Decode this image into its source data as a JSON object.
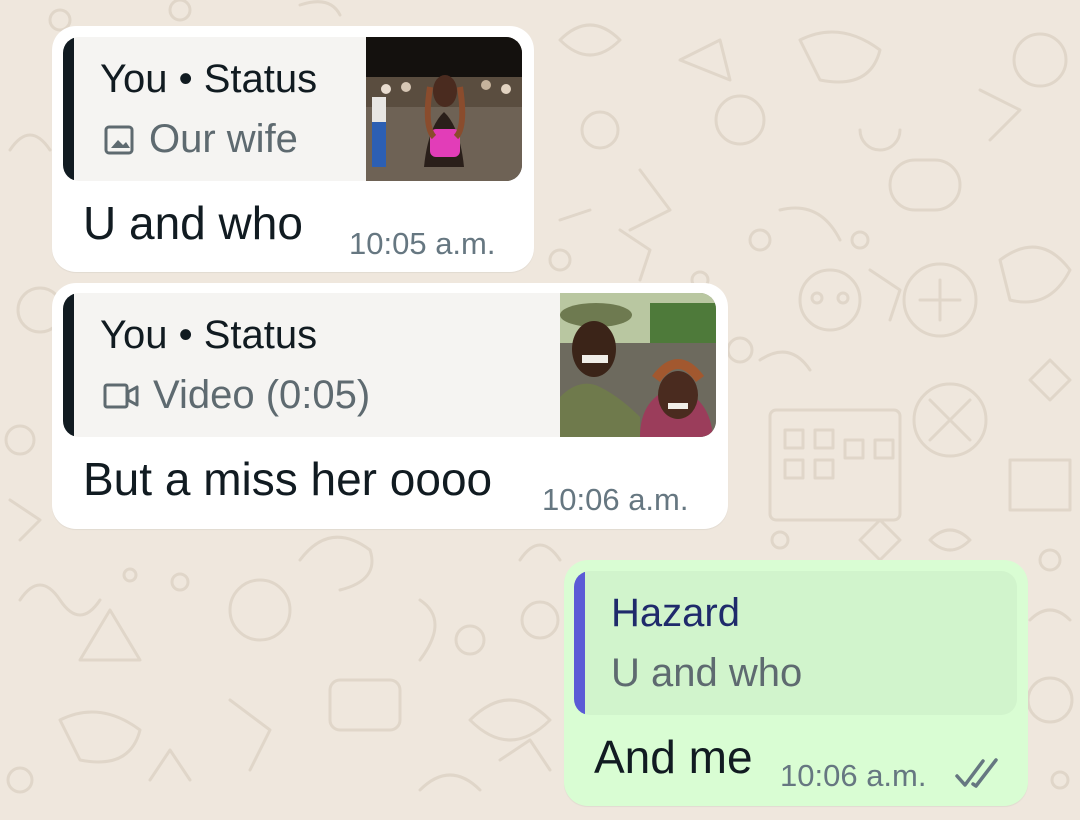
{
  "colors": {
    "incoming_bubble": "#ffffff",
    "outgoing_bubble": "#d9fdd3",
    "quote_bar_status": "#111b21",
    "quote_bar_reply": "#5b5bd6",
    "reply_name": "#1f2a6b",
    "wallpaper": "#efe7dd"
  },
  "messages": [
    {
      "direction": "incoming",
      "quote": {
        "author": "You • Status",
        "media_icon": "image-icon",
        "caption": "Our wife"
      },
      "text": "U and who",
      "time": "10:05 a.m."
    },
    {
      "direction": "incoming",
      "quote": {
        "author": "You • Status",
        "media_icon": "video-icon",
        "caption": "Video (0:05)"
      },
      "text": "But a miss her oooo",
      "time": "10:06 a.m."
    },
    {
      "direction": "outgoing",
      "quote": {
        "author": "Hazard",
        "caption": "U and who"
      },
      "text": "And me",
      "time": "10:06 a.m.",
      "status_icon": "double-check-icon"
    }
  ]
}
